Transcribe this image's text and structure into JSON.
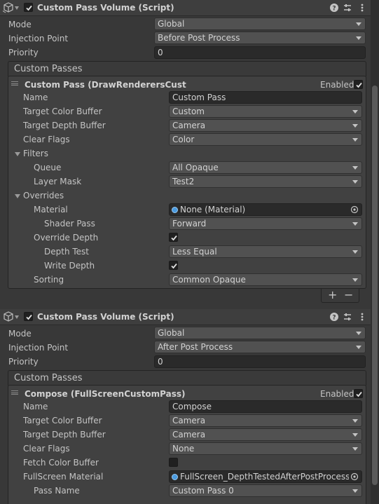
{
  "components": [
    {
      "title": "Custom Pass Volume (Script)",
      "enabled": true,
      "mode_label": "Mode",
      "mode": "Global",
      "injection_label": "Injection Point",
      "injection": "Before Post Process",
      "priority_label": "Priority",
      "priority": "0",
      "passes_header": "Custom Passes",
      "pass": {
        "title": "Custom Pass (DrawRenderersCust",
        "enabled_label": "Enabled",
        "enabled": true,
        "name_label": "Name",
        "name": "Custom Pass",
        "target_color_label": "Target Color Buffer",
        "target_color": "Custom",
        "target_depth_label": "Target Depth Buffer",
        "target_depth": "Camera",
        "clear_flags_label": "Clear Flags",
        "clear_flags": "Color",
        "filters_label": "Filters",
        "queue_label": "Queue",
        "queue": "All Opaque",
        "layer_mask_label": "Layer Mask",
        "layer_mask": "Test2",
        "overrides_label": "Overrides",
        "material_label": "Material",
        "material": "None (Material)",
        "shader_pass_label": "Shader Pass",
        "shader_pass": "Forward",
        "override_depth_label": "Override Depth",
        "override_depth": true,
        "depth_test_label": "Depth Test",
        "depth_test": "Less Equal",
        "write_depth_label": "Write Depth",
        "write_depth": true,
        "sorting_label": "Sorting",
        "sorting": "Common Opaque"
      },
      "add_label": "+",
      "remove_label": "−"
    },
    {
      "title": "Custom Pass Volume (Script)",
      "enabled": true,
      "mode_label": "Mode",
      "mode": "Global",
      "injection_label": "Injection Point",
      "injection": "After Post Process",
      "priority_label": "Priority",
      "priority": "0",
      "passes_header": "Custom Passes",
      "pass": {
        "title": "Compose (FullScreenCustomPass)",
        "enabled_label": "Enabled",
        "enabled": true,
        "name_label": "Name",
        "name": "Compose",
        "target_color_label": "Target Color Buffer",
        "target_color": "Camera",
        "target_depth_label": "Target Depth Buffer",
        "target_depth": "Camera",
        "clear_flags_label": "Clear Flags",
        "clear_flags": "None",
        "fetch_color_label": "Fetch Color Buffer",
        "fetch_color": false,
        "fullscreen_material_label": "FullScreen Material",
        "fullscreen_material": "FullScreen_DepthTestedAfterPostProcess",
        "pass_name_label": "Pass Name",
        "pass_name": "Custom Pass 0"
      }
    }
  ]
}
